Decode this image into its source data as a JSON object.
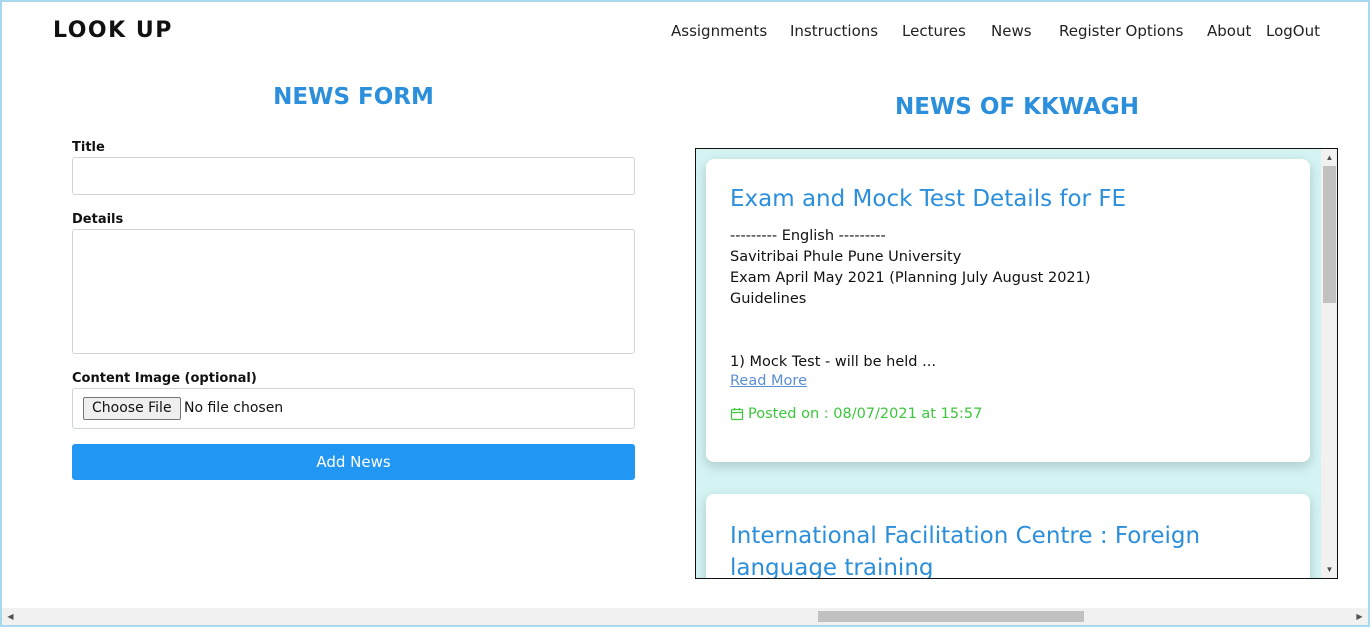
{
  "brand": "LOOK UP",
  "nav": {
    "items": [
      {
        "label": "Assignments"
      },
      {
        "label": "Instructions"
      },
      {
        "label": "Lectures"
      },
      {
        "label": "News"
      },
      {
        "label": "Register Options"
      },
      {
        "label": "About"
      },
      {
        "label": "LogOut"
      }
    ]
  },
  "form": {
    "title": "NEWS FORM",
    "title_label": "Title",
    "title_value": "",
    "details_label": "Details",
    "details_value": "",
    "image_label": "Content Image (optional)",
    "choose_file_label": "Choose File",
    "no_file_text": "No file chosen",
    "submit_label": "Add News"
  },
  "news": {
    "heading": "NEWS OF KKWAGH",
    "cards": [
      {
        "title": "Exam and Mock Test Details for FE",
        "body": "--------- English ---------\nSavitribai Phule Pune University\nExam April May 2021 (Planning July August 2021)\nGuidelines\n\n\n1) Mock Test - will be held ...",
        "read_more": "Read More",
        "posted": "Posted on : 08/07/2021 at 15:57"
      },
      {
        "title": "International Facilitation Centre : Foreign language training"
      }
    ]
  },
  "icons": {
    "calendar": "calendar-icon",
    "scroll_up": "arrow-up-icon",
    "scroll_down": "arrow-down-icon",
    "scroll_left": "arrow-left-icon",
    "scroll_right": "arrow-right-icon"
  },
  "colors": {
    "accent": "#2b8fdc",
    "button": "#2196f3",
    "posted": "#3cc73c",
    "news_bg": "#d4f3f3"
  }
}
